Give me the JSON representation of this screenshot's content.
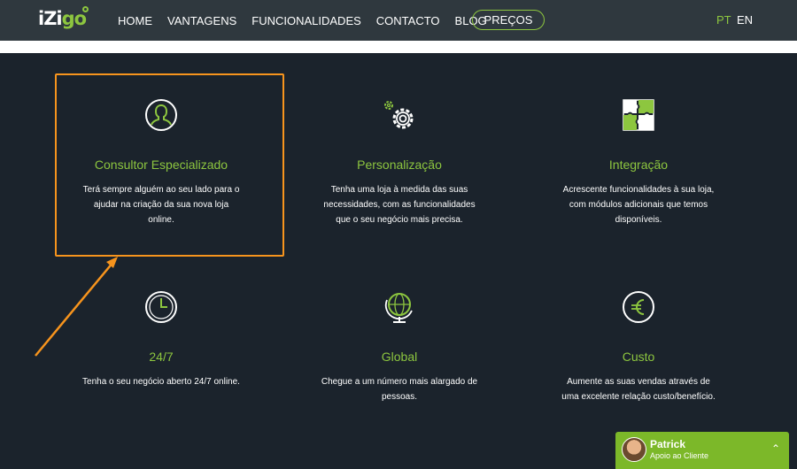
{
  "header": {
    "logo_a": "iZi",
    "logo_b": "go",
    "nav": [
      "HOME",
      "VANTAGENS",
      "FUNCIONALIDADES",
      "CONTACTO",
      "BLOG"
    ],
    "price_button": "PREÇOS",
    "lang_pt": "PT",
    "lang_en": "EN"
  },
  "features": [
    {
      "icon": "user-icon",
      "title": "Consultor Especializado",
      "desc": "Terá sempre alguém ao seu lado para o ajudar na criação da sua nova loja online."
    },
    {
      "icon": "gears-icon",
      "title": "Personalização",
      "desc": "Tenha uma loja à medida das suas necessidades, com as funcionalidades que o seu negócio mais precisa."
    },
    {
      "icon": "puzzle-icon",
      "title": "Integração",
      "desc": "Acrescente funcionalidades à sua loja, com módulos adicionais que temos disponíveis."
    },
    {
      "icon": "clock-icon",
      "title": "24/7",
      "desc": "Tenha o seu negócio aberto 24/7 online."
    },
    {
      "icon": "globe-icon",
      "title": "Global",
      "desc": "Chegue a um número mais alargado de pessoas."
    },
    {
      "icon": "euro-icon",
      "title": "Custo",
      "desc": "Aumente as suas vendas através de uma excelente relação custo/benefício."
    }
  ],
  "chat": {
    "name": "Patrick",
    "role": "Apoio ao Cliente"
  },
  "colors": {
    "accent": "#8dc63f",
    "header_bg": "#2f383e",
    "section_bg": "#1b232c",
    "highlight": "#f7941d"
  }
}
